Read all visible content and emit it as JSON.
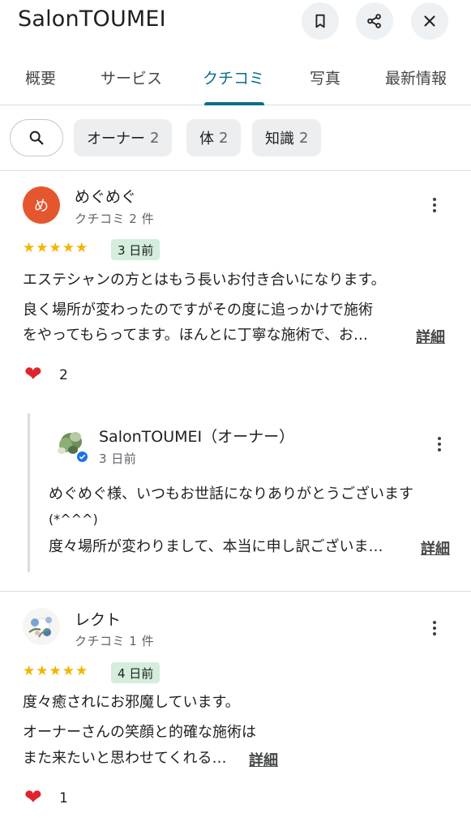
{
  "header": {
    "title": "SalonTOUMEI",
    "icons": [
      "bookmark-icon",
      "share-icon",
      "close-icon"
    ]
  },
  "tabs": [
    "概要",
    "サービス",
    "クチコミ",
    "写真",
    "最新情報"
  ],
  "active_tab": "クチコミ",
  "filters": [
    {
      "label": "オーナー",
      "count": "2"
    },
    {
      "label": "体",
      "count": "2"
    },
    {
      "label": "知識",
      "count": "2"
    }
  ],
  "reviews": [
    {
      "avatar_letter": "め",
      "name": "めぐめぐ",
      "meta": "クチコミ 2 件",
      "stars": "★★★★★",
      "time": "3 日前",
      "lines": [
        "エステシャンの方とはもう長いお付き合いになります。",
        "良く場所が変わったのですがその度に追っかけで施術",
        "をやってもらってます。ほんとに丁寧な施術で、お…"
      ],
      "more_label": "詳細",
      "likes": "2",
      "reply": {
        "name": "SalonTOUMEI（オーナー）",
        "time": "3 日前",
        "lines": [
          "めぐめぐ様、いつもお世話になりありがとうございます",
          "(*^^^)",
          "度々場所が変わりまして、本当に申し訳ございま…"
        ],
        "more_label": "詳細"
      }
    },
    {
      "name": "レクト",
      "meta": "クチコミ 1 件",
      "stars": "★★★★★",
      "time": "4 日前",
      "lines": [
        "度々癒されにお邪魔しています。",
        "オーナーさんの笑顔と的確な施術は",
        "また来たいと思わせてくれる…"
      ],
      "more_label": "詳細",
      "likes": "1"
    }
  ],
  "colors": {
    "accent": "#0b6e8a",
    "star": "#f4b400",
    "badge_bg": "#d4eddd",
    "avatar_bg": "#e4572e",
    "heart": "#e0242c",
    "verified": "#1a73e8"
  }
}
